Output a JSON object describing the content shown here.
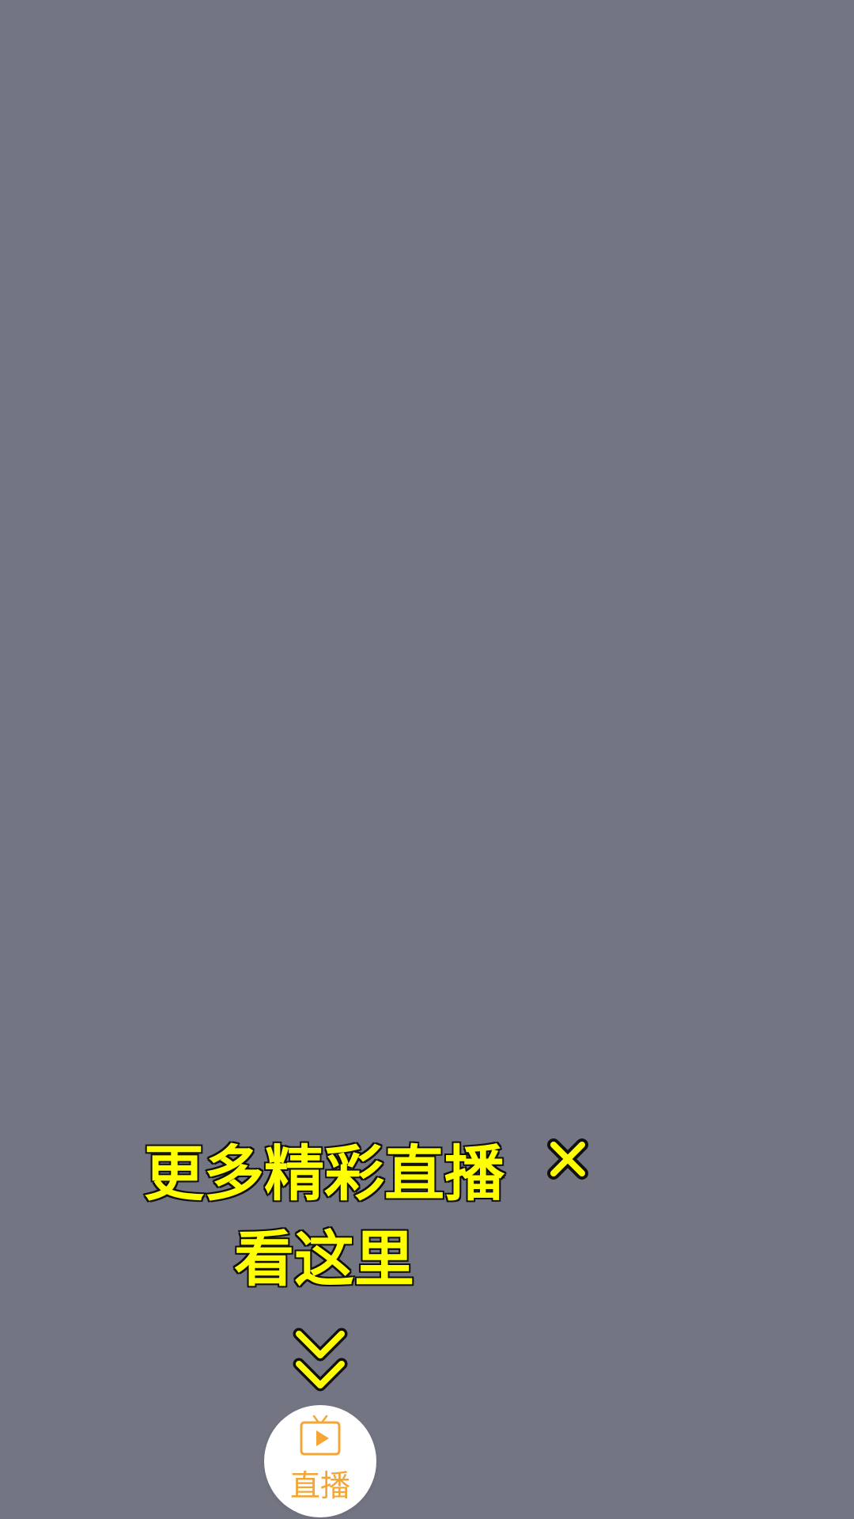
{
  "overlay": {
    "headline_line1": "更多精彩直播",
    "headline_line2": "看这里",
    "close_icon": "close-x-icon",
    "arrow_icon": "double-chevron-down-icon"
  },
  "live_button": {
    "label": "直播",
    "icon": "tv-play-icon"
  },
  "colors": {
    "background": "#747583",
    "headline": "#ffff00",
    "outline": "#111111",
    "accent": "#f4a536",
    "button_bg": "#ffffff"
  }
}
